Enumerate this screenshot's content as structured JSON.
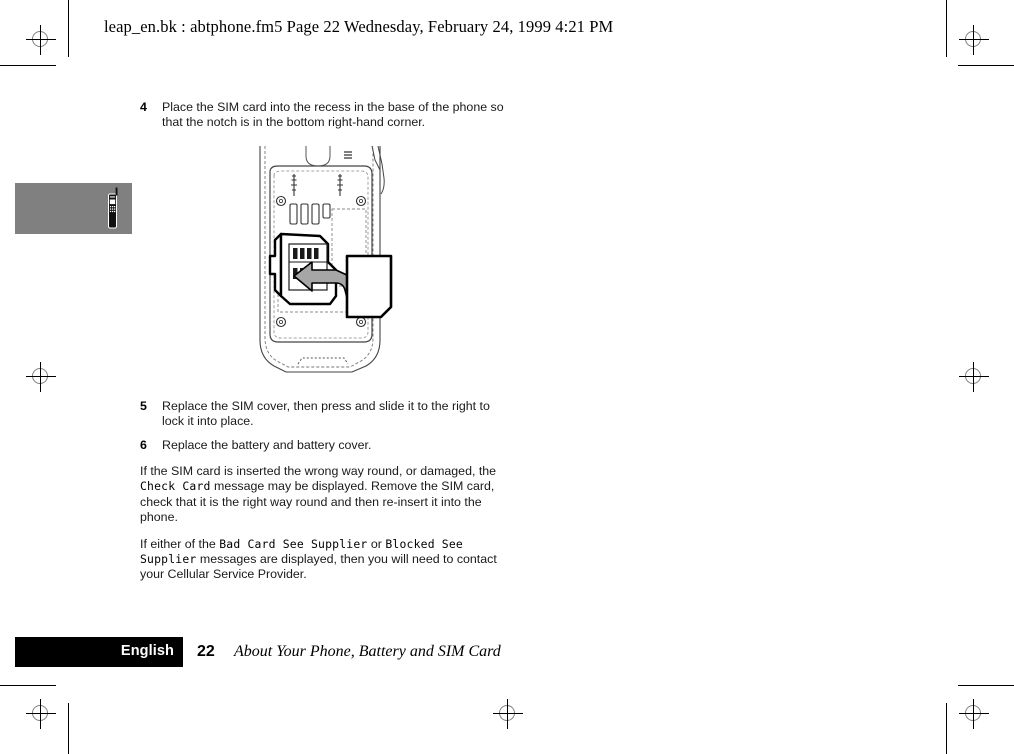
{
  "page": {
    "running_header": "leap_en.bk : abtphone.fm5  Page 22  Wednesday, February 24, 1999  4:21 PM",
    "background_color": "#ffffff"
  },
  "thumb_tab": {
    "icon": "mobile-phone-icon",
    "background_color": "#808080"
  },
  "steps": [
    {
      "number": "4",
      "text": "Place the SIM card into the recess in the base of the phone so that the notch is in the bottom right-hand corner."
    },
    {
      "number": "5",
      "text": "Replace the SIM cover, then press and slide it to the right to lock it into place."
    },
    {
      "number": "6",
      "text": "Replace the battery and battery cover."
    }
  ],
  "paragraphs": [
    {
      "segments": [
        {
          "style": "normal",
          "text": "If the SIM card is inserted the wrong way round, or damaged, the "
        },
        {
          "style": "lcd",
          "text": "Check Card"
        },
        {
          "style": "normal",
          "text": "  message may be displayed. Remove the SIM card, check that it is the right way round and then re-insert it into the phone."
        }
      ]
    },
    {
      "segments": [
        {
          "style": "normal",
          "text": "If either of the "
        },
        {
          "style": "lcd",
          "text": "Bad Card See Supplier"
        },
        {
          "style": "normal",
          "text": " or "
        },
        {
          "style": "lcd",
          "text": "Blocked See Supplier"
        },
        {
          "style": "normal",
          "text": " messages are displayed, then you will need to contact your Cellular Service Provider."
        }
      ]
    }
  ],
  "figure": {
    "name": "phone-sim-slot-diagram",
    "caption_none": "",
    "arrow_color": "#999999",
    "line_color": "#000000"
  },
  "footer": {
    "language": "English",
    "page_number": "22",
    "section_title": "About Your Phone, Battery and SIM Card",
    "bar_color": "#000000"
  },
  "marks": {
    "registration": "registration-crosshair",
    "crop": "crop-rule"
  }
}
